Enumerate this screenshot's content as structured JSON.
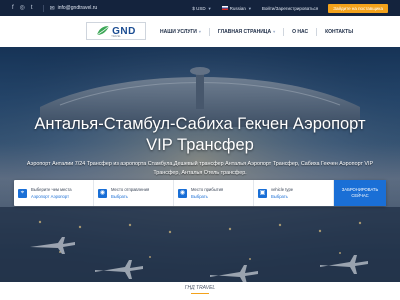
{
  "topbar": {
    "social": [
      {
        "icon": "facebook-icon",
        "glyph": "f"
      },
      {
        "icon": "instagram-icon",
        "glyph": "◎"
      },
      {
        "icon": "twitter-icon",
        "glyph": "t"
      }
    ],
    "email": "info@gndtravel.ru",
    "currency": "$ USD",
    "language": "Russian",
    "login": "Войти/Зарегистрироваться",
    "cta": "Зайдите на поставщика"
  },
  "nav": {
    "logo_text": "GND",
    "logo_sub": "TRAVEL",
    "items": [
      {
        "label": "НАШИ УСЛУГИ",
        "dropdown": true
      },
      {
        "label": "ГЛАВНАЯ СТРАНИЦА",
        "dropdown": true
      },
      {
        "label": "О НАС",
        "dropdown": false
      },
      {
        "label": "КОНТАКТЫ",
        "dropdown": false
      }
    ]
  },
  "hero": {
    "title_line1": "Анталья-Стамбул-Сабиха Гекчен Аэропорт",
    "title_line2": "VIP Трансфер",
    "description": "Аэропорт Анталии 7/24 Трансфер из аэропорта Стамбула,Дешевый трансфер Анталья Аэропорт Трансфер, Сабиха Гекчен Аэропорт VIP Трансфер, Анталья Отель трансфер."
  },
  "search": {
    "fields": [
      {
        "label": "Выберите чем места",
        "value": "Аэропорт Аэропорт",
        "icon": "map-pin-icon"
      },
      {
        "label": "Место отправления",
        "value": "Выбрать",
        "icon": "location-icon"
      },
      {
        "label": "Место прибытия",
        "value": "Выбрать",
        "icon": "location-icon"
      },
      {
        "label": "vehicle type",
        "value": "Выбрать",
        "icon": "car-icon"
      }
    ],
    "button": "ЗАБРОНИРОВАТЬ\nСЕЙЧАС"
  },
  "section": {
    "title": "ГНД TRAVEL"
  },
  "colors": {
    "accent": "#f3a21b",
    "primary": "#1a6fd6",
    "brand": "#1a4c92",
    "topbar": "#14233d"
  }
}
